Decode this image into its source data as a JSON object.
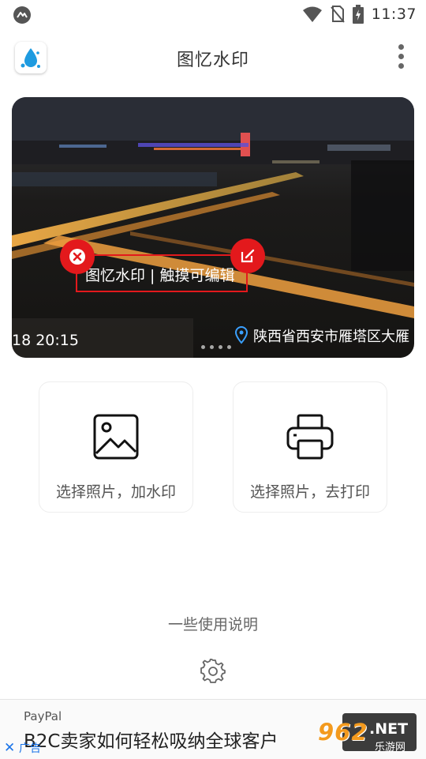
{
  "status_bar": {
    "time": "11:37",
    "icons": [
      "cast-icon",
      "wifi-icon",
      "no-sim-icon",
      "battery-charging-icon"
    ]
  },
  "app_bar": {
    "title": "图忆水印",
    "logo_icon": "water-drop-logo-icon",
    "menu_icon": "overflow-menu-icon"
  },
  "hero": {
    "watermark_text": "图忆水印 | 触摸可编辑",
    "timestamp": "18 20:15",
    "location": "陕西省西安市雁塔区大雁",
    "slide_count": 4,
    "accent_color": "#e3191c"
  },
  "actions": [
    {
      "label": "选择照片，加水印",
      "icon": "image-icon"
    },
    {
      "label": "选择照片，去打印",
      "icon": "printer-icon"
    }
  ],
  "help_link": "一些使用说明",
  "settings_icon": "gear-icon",
  "ad": {
    "brand": "PayPal",
    "text": "B2C卖家如何轻松吸纳全球客户",
    "label": "广告",
    "close": "✕",
    "link_color": "#1a73e8"
  },
  "site_watermark": {
    "number": "962",
    "suffix": ".NET",
    "subtitle": "乐游网"
  }
}
